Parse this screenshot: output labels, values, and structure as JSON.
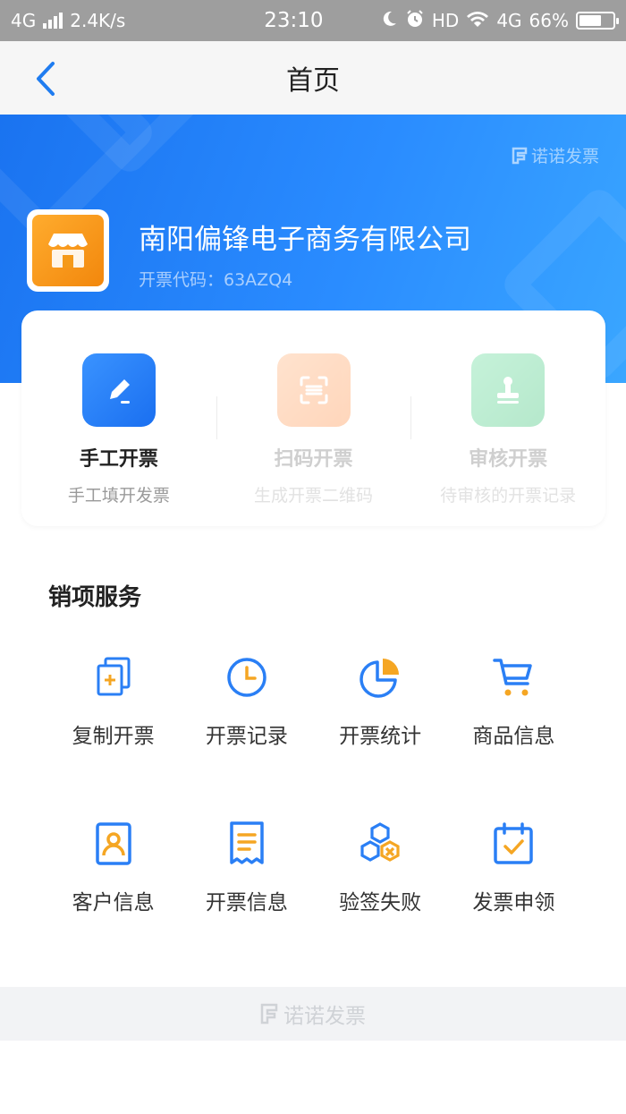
{
  "status_bar": {
    "network": "4G",
    "speed": "2.4K/s",
    "time": "23:10",
    "hd": "HD",
    "network2": "4G",
    "battery": "66%",
    "battery_level": 0.66
  },
  "nav": {
    "title": "首页"
  },
  "hero": {
    "brand": "诺诺发票",
    "company_name": "南阳偏锋电子商务有限公司",
    "invoice_code": "开票代码：63AZQ4"
  },
  "quick_actions": [
    {
      "title": "手工开票",
      "subtitle": "手工填开发票",
      "icon": "pen-icon",
      "color": "#2a7ff5"
    },
    {
      "title": "扫码开票",
      "subtitle": "生成开票二维码",
      "icon": "scan-icon",
      "color": "#ff9a52"
    },
    {
      "title": "审核开票",
      "subtitle": "待审核的开票记录",
      "icon": "stamp-icon",
      "color": "#3ecb7e"
    }
  ],
  "services": {
    "title": "销项服务",
    "items": [
      {
        "label": "复制开票",
        "icon": "copy-doc-icon"
      },
      {
        "label": "开票记录",
        "icon": "clock-icon"
      },
      {
        "label": "开票统计",
        "icon": "pie-chart-icon"
      },
      {
        "label": "商品信息",
        "icon": "cart-icon"
      },
      {
        "label": "客户信息",
        "icon": "contact-card-icon"
      },
      {
        "label": "开票信息",
        "icon": "receipt-icon"
      },
      {
        "label": "验签失败",
        "icon": "hexagons-icon"
      },
      {
        "label": "发票申领",
        "icon": "calendar-check-icon"
      }
    ]
  },
  "footer": {
    "brand": "诺诺发票"
  },
  "colors": {
    "primary": "#2a7ff5",
    "accent": "#f5a623"
  }
}
